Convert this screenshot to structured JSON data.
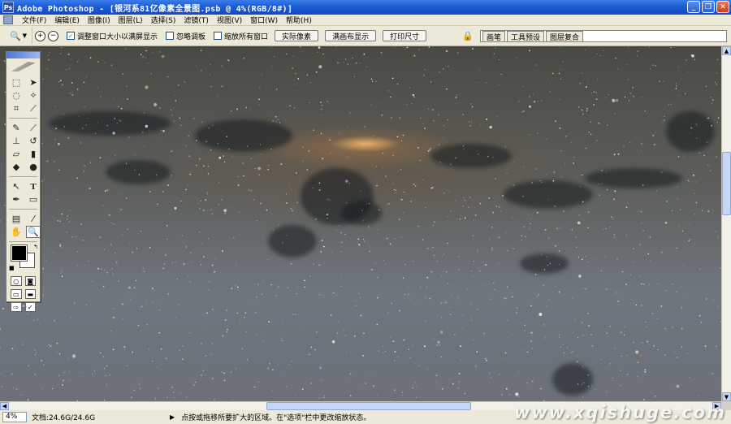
{
  "window": {
    "title": "Adobe Photoshop - [银河系81亿像素全景图.psb @ 4%(RGB/8#)]",
    "app_icon": "photoshop-icon",
    "buttons": [
      "minimize",
      "restore",
      "close"
    ]
  },
  "menu": {
    "items": [
      "文件(F)",
      "编辑(E)",
      "图像(I)",
      "图层(L)",
      "选择(S)",
      "滤镜(T)",
      "视图(V)",
      "窗口(W)",
      "帮助(H)"
    ]
  },
  "options": {
    "resize_windows_label": "调整窗口大小以满屏显示",
    "resize_windows_checked": true,
    "ignore_palettes_label": "忽略调板",
    "ignore_palettes_checked": false,
    "zoom_all_label": "缩放所有窗口",
    "zoom_all_checked": false,
    "actual_pixels_label": "实际像素",
    "fit_screen_label": "满画布显示",
    "print_size_label": "打印尺寸"
  },
  "palette_well": {
    "tabs": [
      "画笔",
      "工具预设",
      "图层复合"
    ]
  },
  "toolbox": {
    "tools": [
      "marquee-icon",
      "move-icon",
      "lasso-icon",
      "magic-wand-icon",
      "crop-icon",
      "slice-icon",
      "healing-brush-icon",
      "brush-icon",
      "clone-stamp-icon",
      "history-brush-icon",
      "eraser-icon",
      "gradient-icon",
      "blur-icon",
      "dodge-icon",
      "path-select-icon",
      "type-icon",
      "pen-icon",
      "shape-icon",
      "notes-icon",
      "eyedropper-icon",
      "hand-icon",
      "zoom-icon"
    ],
    "foreground_color": "#000000",
    "background_color": "#ffffff"
  },
  "status": {
    "zoom": "4%",
    "doc_size": "文档:24.6G/24.6G",
    "hint": "点按或拖移所要扩大的区域。在\"选项\"栏中更改缩放状态。"
  },
  "watermark": "www.xqishuge.com"
}
